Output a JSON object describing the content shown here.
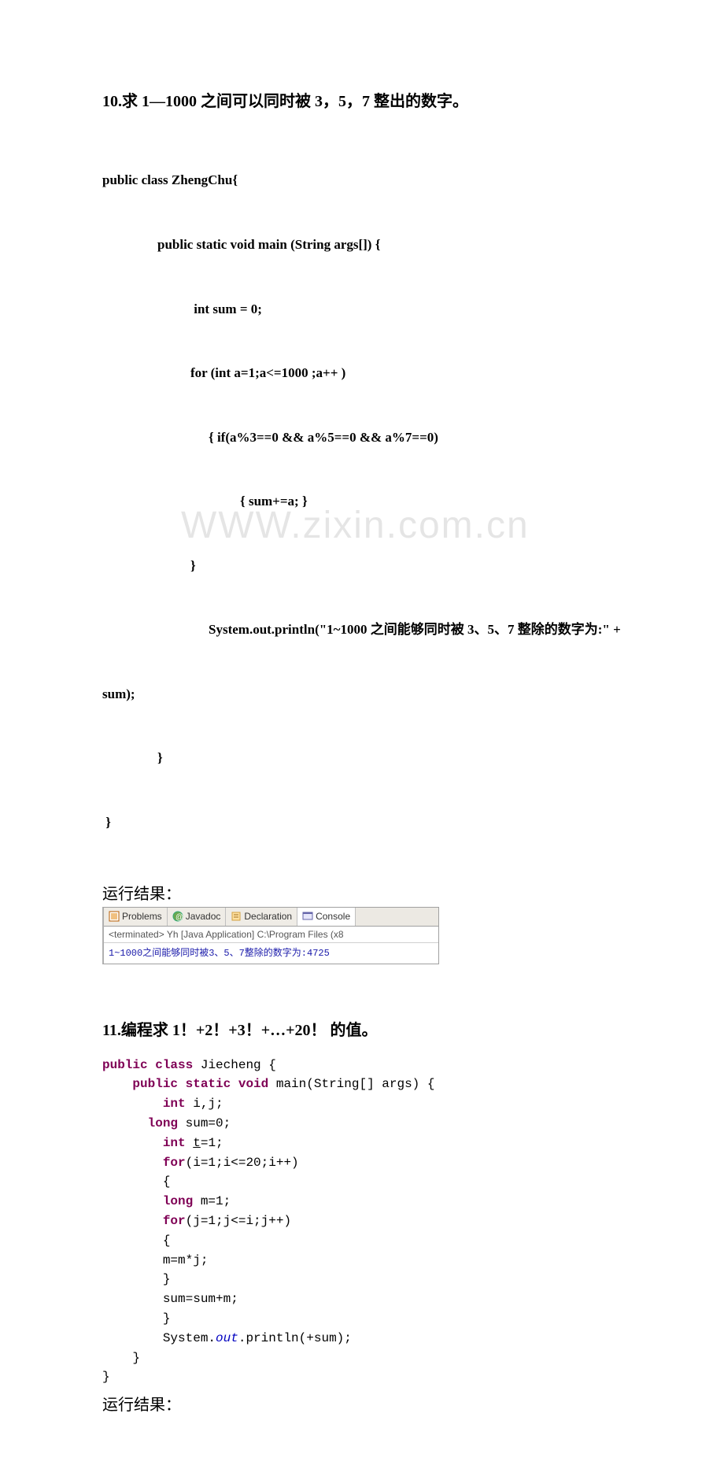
{
  "problem10": {
    "heading": "10.求 1—1000 之间可以同时被 3，5，7 整出的数字。",
    "code": {
      "l1": "public class ZhengChu{",
      "l2": "public static void main (String args[]) {",
      "l3": " int sum = 0;",
      "l4": "for (int a=1;a<=1000 ;a++ )",
      "l5": "{ if(a%3==0 && a%5==0 && a%7==0)",
      "l6": "{ sum+=a; }",
      "l7": "}",
      "l8": "System.out.println(\"1~1000 之间能够同时被 3、5、7 整除的数字为:\" +",
      "l9": "sum);",
      "l10": "}",
      "l11": " }"
    },
    "result_label": "运行结果：",
    "ide": {
      "tabs": {
        "problems": "Problems",
        "javadoc": "Javadoc",
        "declaration": "Declaration",
        "console": "Console"
      },
      "status": "<terminated> Yh [Java Application] C:\\Program Files (x8",
      "output": "1~1000之间能够同时被3、5、7整除的数字为:4725"
    }
  },
  "watermark": "WWW.zixin.com.cn",
  "problem11": {
    "heading": "11.编程求 1！+2！+3！+…+20！ 的值。",
    "code_lines": [
      {
        "indent": 0,
        "segs": [
          {
            "t": "public",
            "c": "kw"
          },
          {
            "t": " ",
            "c": "plain"
          },
          {
            "t": "class",
            "c": "kw"
          },
          {
            "t": " Jiecheng {",
            "c": "plain"
          }
        ]
      },
      {
        "indent": 1,
        "segs": [
          {
            "t": "public",
            "c": "kw"
          },
          {
            "t": " ",
            "c": "plain"
          },
          {
            "t": "static",
            "c": "kw"
          },
          {
            "t": " ",
            "c": "plain"
          },
          {
            "t": "void",
            "c": "kw"
          },
          {
            "t": " main(String[] args) {",
            "c": "plain"
          }
        ]
      },
      {
        "indent": 2,
        "segs": [
          {
            "t": "int",
            "c": "kw"
          },
          {
            "t": " i,j;",
            "c": "plain"
          }
        ]
      },
      {
        "indent": 1.5,
        "segs": [
          {
            "t": "long",
            "c": "kw"
          },
          {
            "t": " sum=0;",
            "c": "plain"
          }
        ]
      },
      {
        "indent": 2,
        "segs": [
          {
            "t": "int",
            "c": "kw"
          },
          {
            "t": " ",
            "c": "plain"
          },
          {
            "t": "t",
            "c": "underline"
          },
          {
            "t": "=1;",
            "c": "plain"
          }
        ]
      },
      {
        "indent": 2,
        "segs": [
          {
            "t": "for",
            "c": "kw"
          },
          {
            "t": "(i=1;i<=20;i++)",
            "c": "plain"
          }
        ]
      },
      {
        "indent": 2,
        "segs": [
          {
            "t": "{",
            "c": "plain"
          }
        ]
      },
      {
        "indent": 2,
        "segs": [
          {
            "t": "long",
            "c": "kw"
          },
          {
            "t": " m=1;",
            "c": "plain"
          }
        ]
      },
      {
        "indent": 2,
        "segs": [
          {
            "t": "for",
            "c": "kw"
          },
          {
            "t": "(j=1;j<=i;j++)",
            "c": "plain"
          }
        ]
      },
      {
        "indent": 2,
        "segs": [
          {
            "t": "{",
            "c": "plain"
          }
        ]
      },
      {
        "indent": 2,
        "segs": [
          {
            "t": "m=m*j;",
            "c": "plain"
          }
        ]
      },
      {
        "indent": 2,
        "segs": [
          {
            "t": "}",
            "c": "plain"
          }
        ]
      },
      {
        "indent": 2,
        "segs": [
          {
            "t": "sum=sum+m;",
            "c": "plain"
          }
        ]
      },
      {
        "indent": 2,
        "segs": [
          {
            "t": "}",
            "c": "plain"
          }
        ]
      },
      {
        "indent": 2,
        "segs": [
          {
            "t": "System.",
            "c": "plain"
          },
          {
            "t": "out",
            "c": "static-it"
          },
          {
            "t": ".println(+sum);",
            "c": "plain"
          }
        ]
      },
      {
        "indent": 1,
        "segs": [
          {
            "t": "}",
            "c": "plain"
          }
        ]
      },
      {
        "indent": 0,
        "segs": [
          {
            "t": "}",
            "c": "plain"
          }
        ]
      }
    ],
    "result_label": "运行结果："
  }
}
